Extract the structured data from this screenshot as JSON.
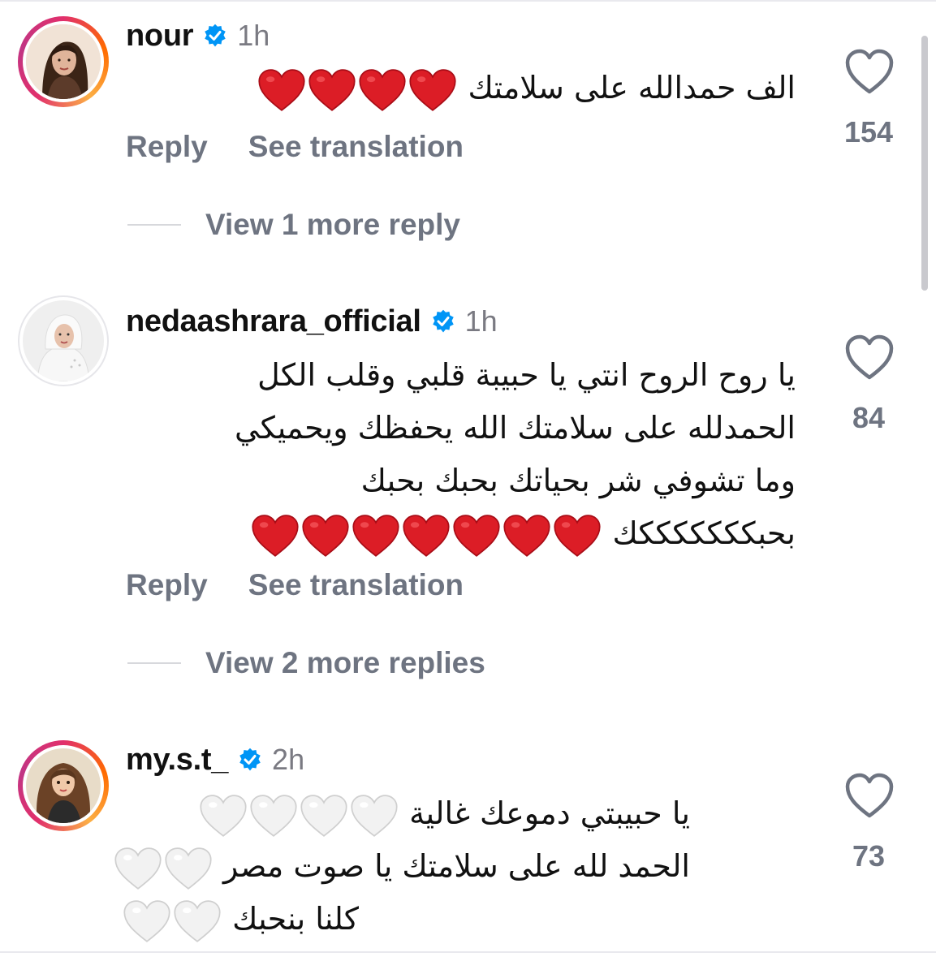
{
  "comments": [
    {
      "username": "nour",
      "time": "1h",
      "lines": [
        "الف حمدالله على سلامتك"
      ],
      "emoji_lines": [
        [
          4,
          "red"
        ]
      ],
      "likes": "154",
      "reply_label": "Reply",
      "translate_label": "See translation",
      "view_more": "View 1 more reply"
    },
    {
      "username": "nedaashrara_official",
      "time": "1h",
      "lines": [
        "يا روح الروح انتي يا حبيبة قلبي وقلب الكل",
        "الحمدلله على سلامتك الله يحفظك ويحميكي",
        "وما تشوفي شر بحياتك بحبك بحبك",
        "بحبكككككككك"
      ],
      "likes": "84",
      "reply_label": "Reply",
      "translate_label": "See translation",
      "view_more": "View 2 more replies"
    },
    {
      "username": "my.s.t_",
      "time": "2h",
      "lines": [
        "يا حبيبتي دموعك غالية",
        "الحمد لله على سلامتك يا صوت مصر",
        "كلنا بنحبك"
      ],
      "likes": "73"
    }
  ],
  "colors": {
    "accent_blue": "#0095f6",
    "heart_red": "#e3172b",
    "muted": "#6e7481"
  },
  "icons": [
    "verified-badge-icon",
    "heart-outline-icon",
    "red-heart-emoji",
    "white-heart-emoji"
  ]
}
